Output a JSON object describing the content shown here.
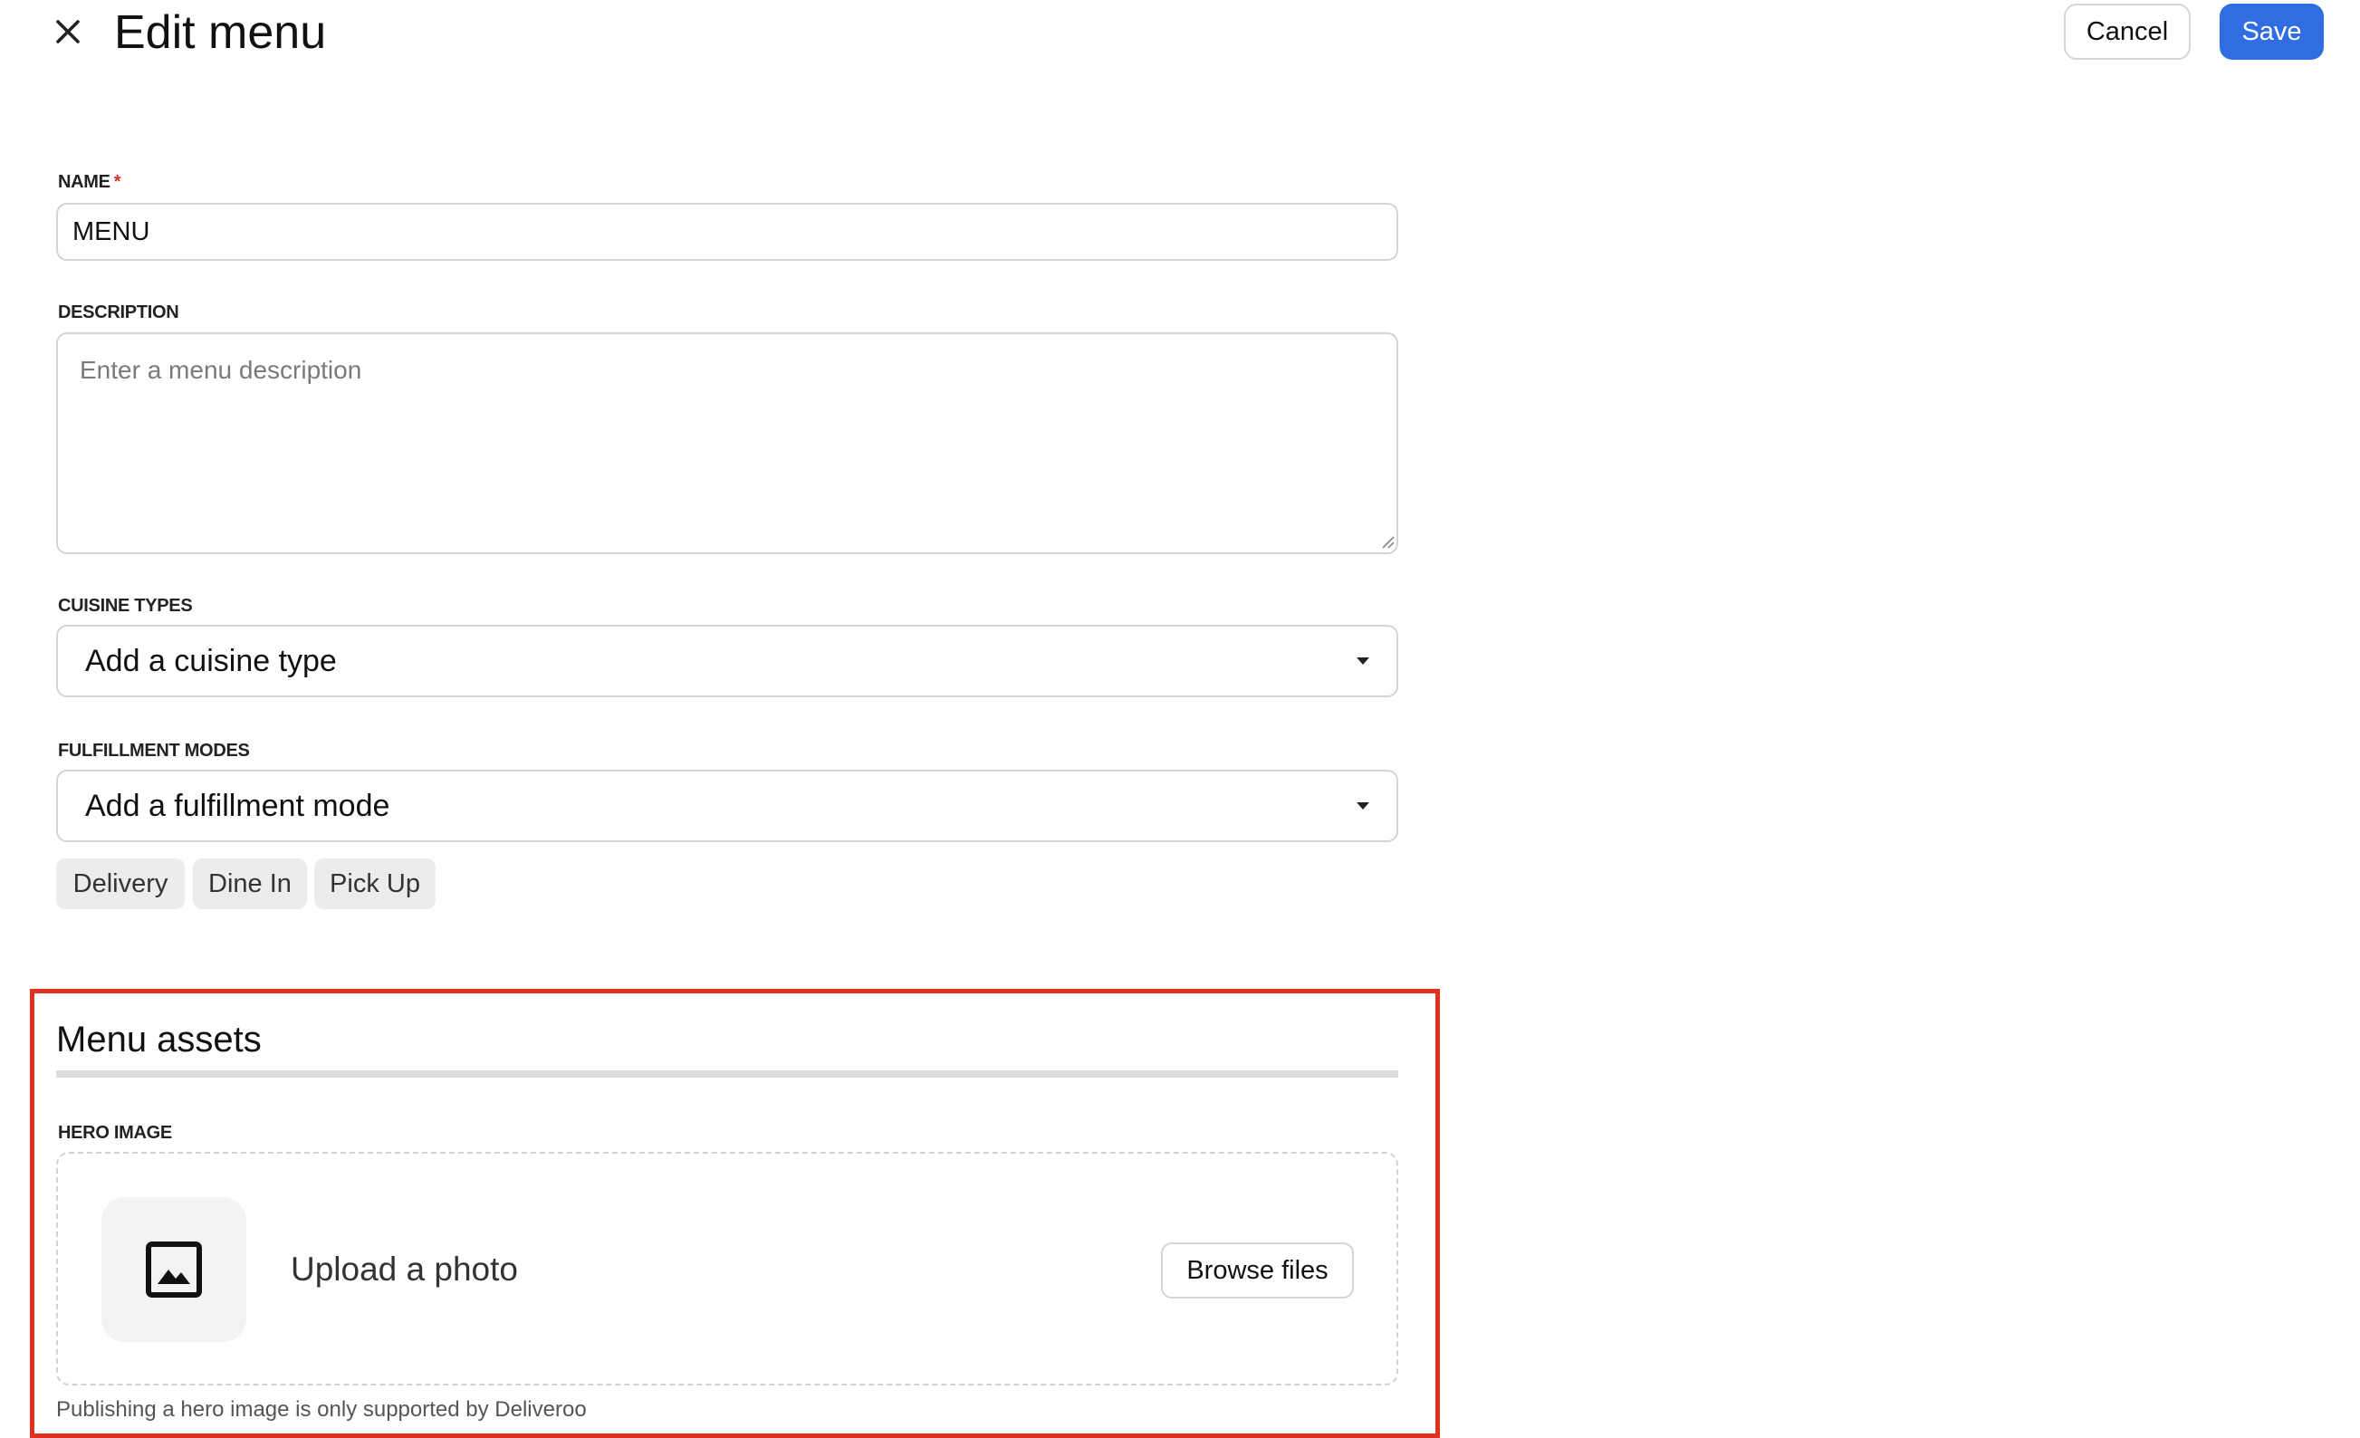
{
  "header": {
    "title": "Edit menu",
    "close_icon": "close-icon",
    "cancel_label": "Cancel",
    "save_label": "Save"
  },
  "colors": {
    "primary": "#2f6de0",
    "required": "#d93025",
    "highlight_frame": "#e0301e"
  },
  "form": {
    "name": {
      "label": "NAME",
      "required_mark": "*",
      "value": "MENU"
    },
    "description": {
      "label": "DESCRIPTION",
      "placeholder": "Enter a menu description",
      "value": ""
    },
    "cuisine_types": {
      "label": "CUISINE TYPES",
      "selected": "Add a cuisine type"
    },
    "fulfillment_modes": {
      "label": "FULFILLMENT MODES",
      "selected": "Add a fulfillment mode",
      "chips": [
        "Delivery",
        "Dine In",
        "Pick Up"
      ]
    }
  },
  "assets": {
    "title": "Menu assets",
    "hero_image": {
      "label": "HERO IMAGE",
      "upload_label": "Upload a photo",
      "icon": "image-icon",
      "browse_label": "Browse files",
      "help_text": "Publishing a hero image is only supported by Deliveroo"
    }
  }
}
